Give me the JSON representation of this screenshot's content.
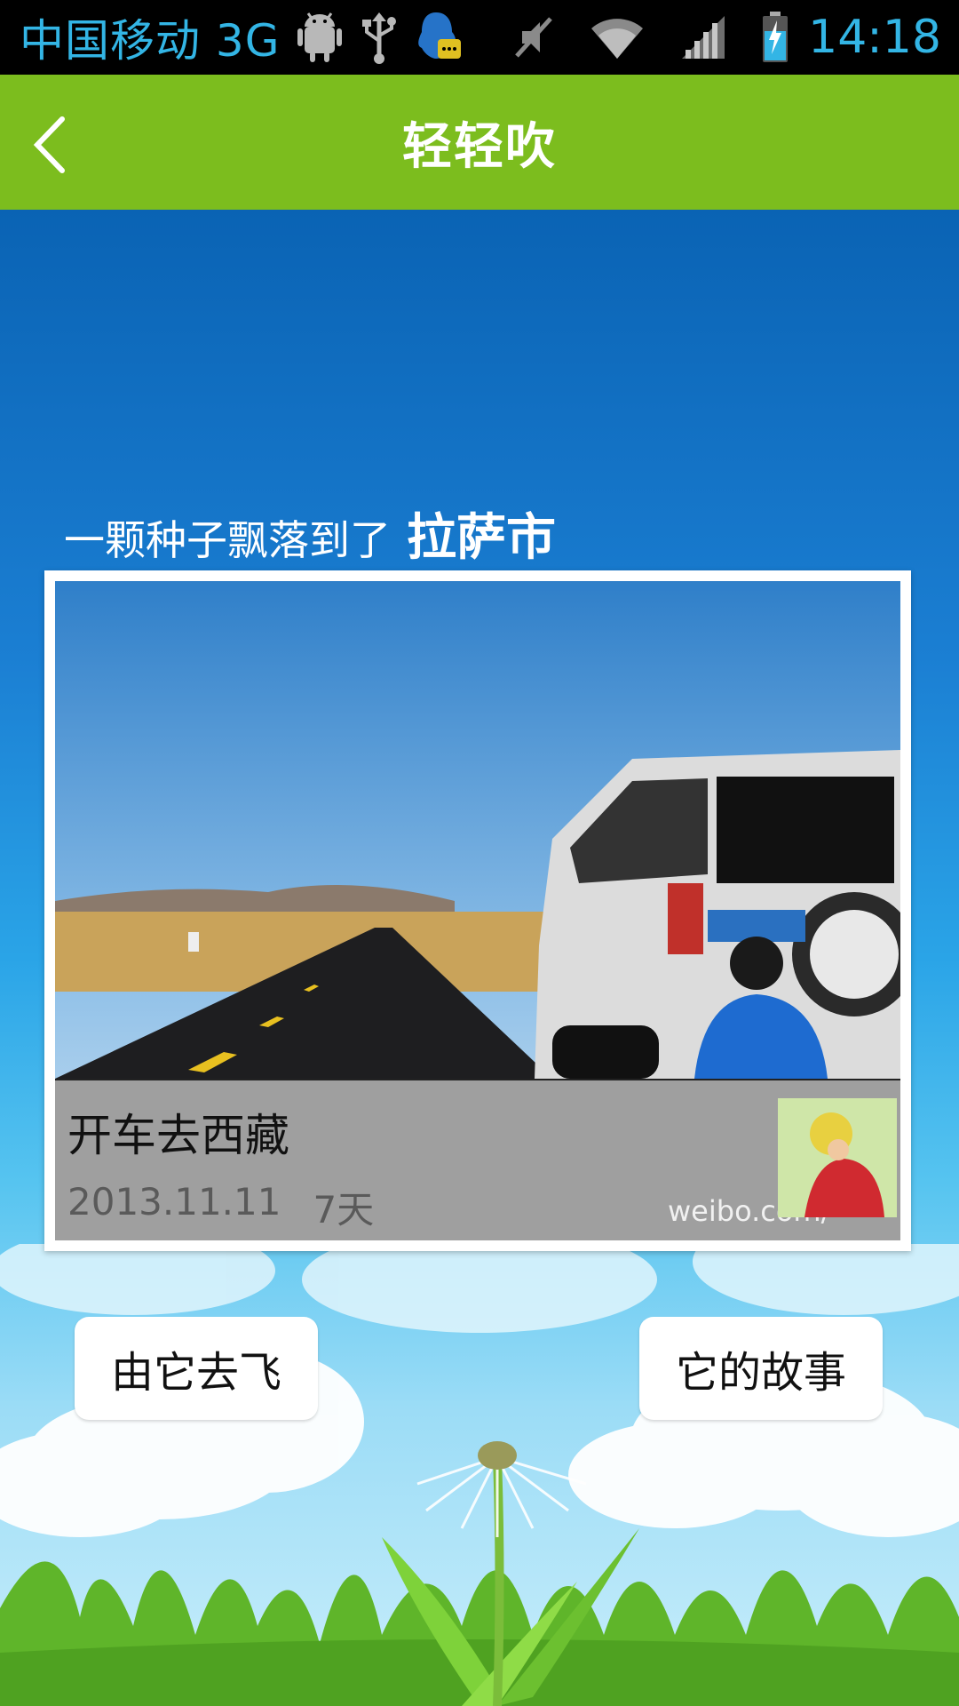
{
  "status_bar": {
    "carrier": "中国移动 3G",
    "time": "14:18",
    "icons": [
      "android-debug-icon",
      "usb-icon",
      "qq-notification-icon",
      "mute-icon",
      "wifi-icon",
      "signal-icon",
      "battery-charging-icon"
    ]
  },
  "header": {
    "title": "轻轻吹",
    "back_icon": "back-chevron-icon",
    "color": "#7cbd1e"
  },
  "seed": {
    "text": "一颗种子飘落到了",
    "city": "拉萨市"
  },
  "card": {
    "title": "开车去西藏",
    "date": "2013.11.11",
    "duration": "7天",
    "watermark": "weibo.com/"
  },
  "actions": {
    "let_fly": "由它去飞",
    "its_story": "它的故事"
  },
  "colors": {
    "status_text": "#33b5e5",
    "sky_top": "#0a63b4",
    "grass": "#6cc030"
  }
}
